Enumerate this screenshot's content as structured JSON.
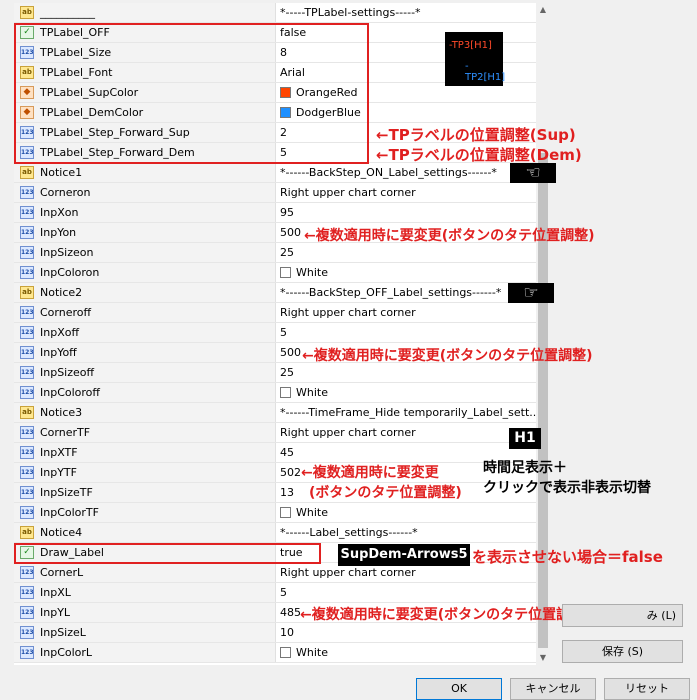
{
  "rows": [
    {
      "icon": "ab",
      "name": "__________",
      "value": "*-----TPLabel-settings-----*"
    },
    {
      "icon": "bool",
      "name": "TPLabel_OFF",
      "value": "false"
    },
    {
      "icon": "num",
      "name": "TPLabel_Size",
      "value": "8"
    },
    {
      "icon": "ab",
      "name": "TPLabel_Font",
      "value": "Arial"
    },
    {
      "icon": "color",
      "name": "TPLabel_SupColor",
      "value": "OrangeRed",
      "swatch": "#ff4500"
    },
    {
      "icon": "color",
      "name": "TPLabel_DemColor",
      "value": "DodgerBlue",
      "swatch": "#1e90ff"
    },
    {
      "icon": "num",
      "name": "TPLabel_Step_Forward_Sup",
      "value": "2"
    },
    {
      "icon": "num",
      "name": "TPLabel_Step_Forward_Dem",
      "value": "5"
    },
    {
      "icon": "ab",
      "name": "Notice1",
      "value": "*------BackStep_ON_Label_settings------*"
    },
    {
      "icon": "num",
      "name": "Corneron",
      "value": "Right upper chart corner"
    },
    {
      "icon": "num",
      "name": "InpXon",
      "value": "95"
    },
    {
      "icon": "num",
      "name": "InpYon",
      "value": "500"
    },
    {
      "icon": "num",
      "name": "InpSizeon",
      "value": "25"
    },
    {
      "icon": "num",
      "name": "InpColoron",
      "value": "White",
      "swatch": "#ffffff"
    },
    {
      "icon": "ab",
      "name": "Notice2",
      "value": "*------BackStep_OFF_Label_settings------*"
    },
    {
      "icon": "num",
      "name": "Corneroff",
      "value": "Right upper chart corner"
    },
    {
      "icon": "num",
      "name": "InpXoff",
      "value": "5"
    },
    {
      "icon": "num",
      "name": "InpYoff",
      "value": "500"
    },
    {
      "icon": "num",
      "name": "InpSizeoff",
      "value": "25"
    },
    {
      "icon": "num",
      "name": "InpColoroff",
      "value": "White",
      "swatch": "#ffffff"
    },
    {
      "icon": "ab",
      "name": "Notice3",
      "value": "*------TimeFrame_Hide temporarily_Label_sett..."
    },
    {
      "icon": "num",
      "name": "CornerTF",
      "value": "Right upper chart corner"
    },
    {
      "icon": "num",
      "name": "InpXTF",
      "value": "45"
    },
    {
      "icon": "num",
      "name": "InpYTF",
      "value": "502"
    },
    {
      "icon": "num",
      "name": "InpSizeTF",
      "value": "13"
    },
    {
      "icon": "num",
      "name": "InpColorTF",
      "value": "White",
      "swatch": "#ffffff"
    },
    {
      "icon": "ab",
      "name": "Notice4",
      "value": "*------Label_settings------*"
    },
    {
      "icon": "bool",
      "name": "Draw_Label",
      "value": "true"
    },
    {
      "icon": "num",
      "name": "CornerL",
      "value": "Right upper chart corner"
    },
    {
      "icon": "num",
      "name": "InpXL",
      "value": "5"
    },
    {
      "icon": "num",
      "name": "InpYL",
      "value": "485"
    },
    {
      "icon": "num",
      "name": "InpSizeL",
      "value": "10"
    },
    {
      "icon": "num",
      "name": "InpColorL",
      "value": "White",
      "swatch": "#ffffff"
    }
  ],
  "annotations": {
    "tp_sup": "←TPラベルの位置調整(Sup)",
    "tp_dem": "←TPラベルの位置調整(Dem)",
    "yon": "←複数適用時に要変更(ボタンのタテ位置調整)",
    "yoff": "←複数適用時に要変更(ボタンのタテ位置調整)",
    "ytf_1": "←複数適用時に要変更",
    "ytf_2": "(ボタンのタテ位置調整)",
    "yl": "←複数適用時に要変更(ボタンのタテ位置調整)",
    "draw_label_note": "を表示させない場合＝false"
  },
  "preview": {
    "tp3": "-TP3[H1]",
    "tp2": "-TP2[H1]",
    "h1": "H1",
    "supdem": "SupDem-Arrows5"
  },
  "tf_desc": {
    "line1": "時間足表示＋",
    "line2": "クリックで表示非表示切替"
  },
  "buttons": {
    "reset_partial": "み (L)",
    "save": "保存 (S)",
    "ok": "OK",
    "cancel": "キャンセル",
    "reset": "リセット"
  },
  "colors": {
    "accent_red": "#e02020",
    "orange_red": "#ff4500",
    "dodger_blue": "#1e90ff"
  }
}
